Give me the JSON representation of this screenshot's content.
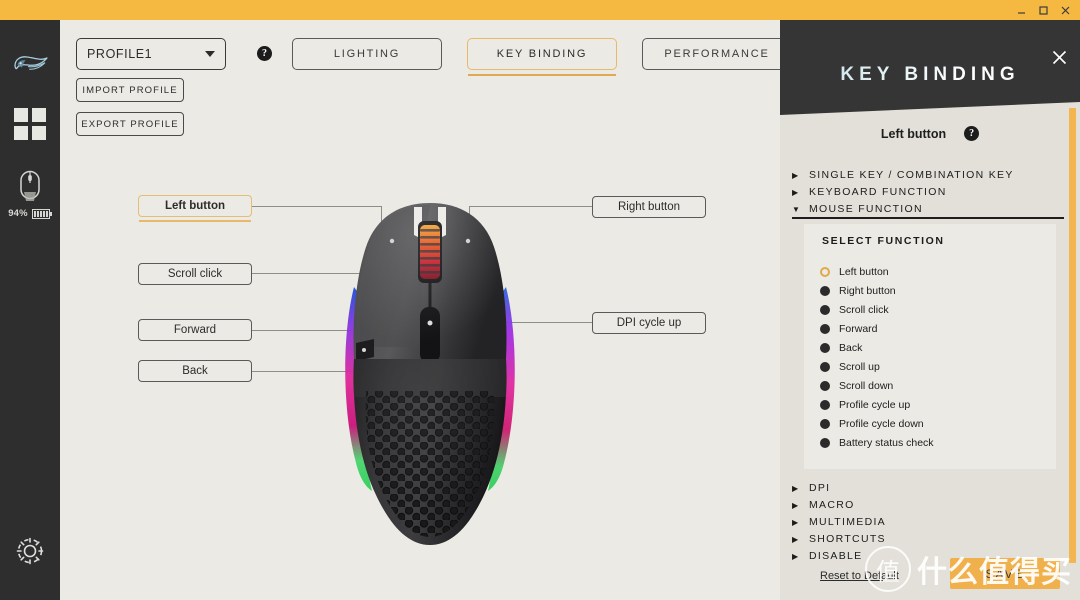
{
  "window": {
    "titlebar_color": "#f5b942",
    "controls": [
      {
        "name": "minimize",
        "glyph": "minimize-icon"
      },
      {
        "name": "maximize",
        "glyph": "maximize-icon"
      },
      {
        "name": "close",
        "glyph": "close-icon"
      }
    ]
  },
  "sidebar": {
    "logo": "glorious-logo-icon",
    "items": [
      {
        "name": "devices-grid-icon",
        "label": ""
      },
      {
        "name": "mouse-device-icon",
        "label": ""
      }
    ],
    "battery": {
      "percent": "94%",
      "icon": "battery-icon"
    },
    "settings": {
      "name": "gear-icon"
    }
  },
  "main": {
    "profile": {
      "value": "PROFILE1",
      "icon": "chevron-down-icon"
    },
    "import_label": "IMPORT PROFILE",
    "export_label": "EXPORT PROFILE",
    "help_icon": "help-circle-icon",
    "tabs": [
      {
        "label": "LIGHTING",
        "active": false
      },
      {
        "label": "KEY BINDING",
        "active": true
      },
      {
        "label": "PERFORMANCE",
        "active": false
      }
    ],
    "callouts_left": [
      {
        "label": "Left button",
        "selected": true
      },
      {
        "label": "Scroll click",
        "selected": false
      },
      {
        "label": "Forward",
        "selected": false
      },
      {
        "label": "Back",
        "selected": false
      }
    ],
    "callouts_right": [
      {
        "label": "Right button",
        "selected": false
      },
      {
        "label": "DPI cycle up",
        "selected": false
      }
    ],
    "device_image": "wireless-gaming-mouse-honeycomb-rgb"
  },
  "panel": {
    "title": "KEY BINDING",
    "close_icon": "close-icon",
    "subtitle": "Left button",
    "subtitle_help_icon": "help-circle-icon",
    "accordion_top": [
      {
        "label": "SINGLE KEY / COMBINATION KEY",
        "expanded": false,
        "arrow": "▶"
      },
      {
        "label": "KEYBOARD FUNCTION",
        "expanded": false,
        "arrow": "▶"
      },
      {
        "label": "MOUSE FUNCTION",
        "expanded": true,
        "arrow": "▼"
      }
    ],
    "select_function": {
      "title": "SELECT FUNCTION",
      "options": [
        {
          "label": "Left button",
          "selected": true
        },
        {
          "label": "Right button",
          "selected": false
        },
        {
          "label": "Scroll click",
          "selected": false
        },
        {
          "label": "Forward",
          "selected": false
        },
        {
          "label": "Back",
          "selected": false
        },
        {
          "label": "Scroll up",
          "selected": false
        },
        {
          "label": "Scroll down",
          "selected": false
        },
        {
          "label": "Profile cycle up",
          "selected": false
        },
        {
          "label": "Profile cycle down",
          "selected": false
        },
        {
          "label": "Battery status check",
          "selected": false
        }
      ]
    },
    "accordion_bottom": [
      {
        "label": "DPI",
        "arrow": "▶"
      },
      {
        "label": "MACRO",
        "arrow": "▶"
      },
      {
        "label": "MULTIMEDIA",
        "arrow": "▶"
      },
      {
        "label": "SHORTCUTS",
        "arrow": "▶"
      },
      {
        "label": "DISABLE",
        "arrow": "▶"
      }
    ],
    "reset_label": "Reset to Default",
    "save_label": "SAVE",
    "accent_color": "#f0b04c"
  },
  "watermark": {
    "mark": "值",
    "text": "什么值得买"
  }
}
